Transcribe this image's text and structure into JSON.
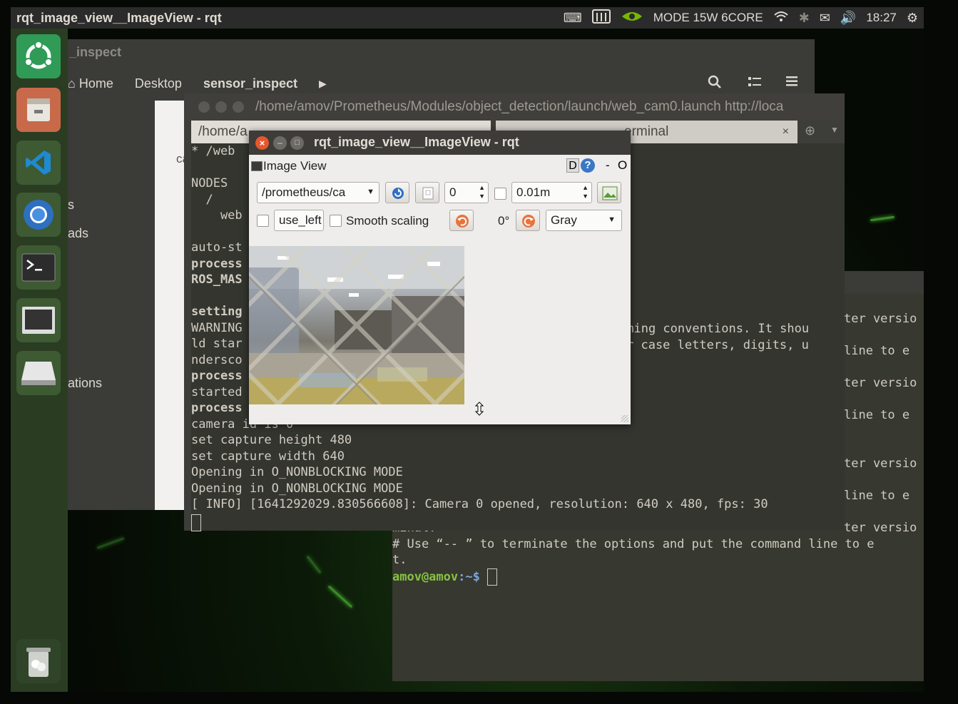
{
  "top_panel": {
    "window_title": "rqt_image_view__ImageView - rqt",
    "power_mode": "MODE 15W 6CORE",
    "time": "18:27"
  },
  "launcher": {
    "items": [
      "ubuntu-dash",
      "files",
      "vscode",
      "chromium",
      "terminal",
      "monitor",
      "removable-drive"
    ],
    "trash": "trash"
  },
  "files_window": {
    "title_fragment": "_inspect",
    "breadcrumbs": [
      "Home",
      "Desktop",
      "sensor_inspect"
    ],
    "sidebar_fragments": [
      "s",
      "ads",
      "ations"
    ],
    "content_fragment": "ca"
  },
  "terminal1": {
    "title": "/home/amov/Prometheus/Modules/object_detection/launch/web_cam0.launch http://loca",
    "tab1": "/home/a",
    "tab2": "erminal",
    "tab_close": "×",
    "lines": [
      {
        "text": "* /web",
        "bold": false
      },
      {
        "text": "",
        "bold": false
      },
      {
        "text": "NODES",
        "bold": false
      },
      {
        "text": "  /",
        "bold": false
      },
      {
        "text": "    web",
        "bold": false
      },
      {
        "text": "",
        "bold": false
      },
      {
        "text": "auto-st",
        "bold": false
      },
      {
        "text": "process",
        "bold": true
      },
      {
        "text": "ROS_MAS",
        "bold": true
      },
      {
        "text": "",
        "bold": false
      },
      {
        "text": "setting",
        "bold": true
      },
      {
        "text": "WARNING",
        "bold": false
      },
      {
        "text": "ld star",
        "bold": false
      },
      {
        "text": "ndersco",
        "bold": false
      },
      {
        "text": "process",
        "bold": true
      },
      {
        "text": "started",
        "bold": false
      },
      {
        "text": "process",
        "bold": true
      },
      {
        "text": "camera id is 0",
        "bold": false
      },
      {
        "text": "set capture height 480",
        "bold": false
      },
      {
        "text": "set capture width 640",
        "bold": false
      },
      {
        "text": "Opening in O_NONBLOCKING MODE",
        "bold": false
      },
      {
        "text": "Opening in O_NONBLOCKING MODE",
        "bold": false
      },
      {
        "text": "[ INFO] [1641292029.830566608]: Camera 0 opened, resolution: 640 x 480, fps: 30",
        "bold": false
      }
    ],
    "overlay_lines": [
      "aming conventions. It shou",
      "r case letters, digits, u"
    ]
  },
  "terminal2": {
    "right_fragments": [
      "ter versio",
      "",
      "line to e",
      "",
      "ter versio",
      "",
      "line to e",
      "",
      "",
      "ter versio",
      "",
      "line to e",
      "",
      "ter versio"
    ],
    "tail_lines": [
      "minal.",
      "# Use “-- ” to terminate the options and put the command line to e",
      "t."
    ],
    "prompt_user": "amov@amov",
    "prompt_path": ":~$ "
  },
  "rqt": {
    "title": "rqt_image_view__ImageView - rqt",
    "close": "×",
    "minimize": "–",
    "maximize": "□",
    "plugin_name": "Image View",
    "dock_d": "D",
    "dock_help": "?",
    "dock_dash": "-",
    "dock_o": "O",
    "topic": "/prometheus/ca",
    "spin_value": "0",
    "max_value": "0.01m",
    "mouse_topic": "use_left",
    "smooth_scaling": "Smooth scaling",
    "rotation": "0°",
    "color_scheme": "Gray"
  }
}
